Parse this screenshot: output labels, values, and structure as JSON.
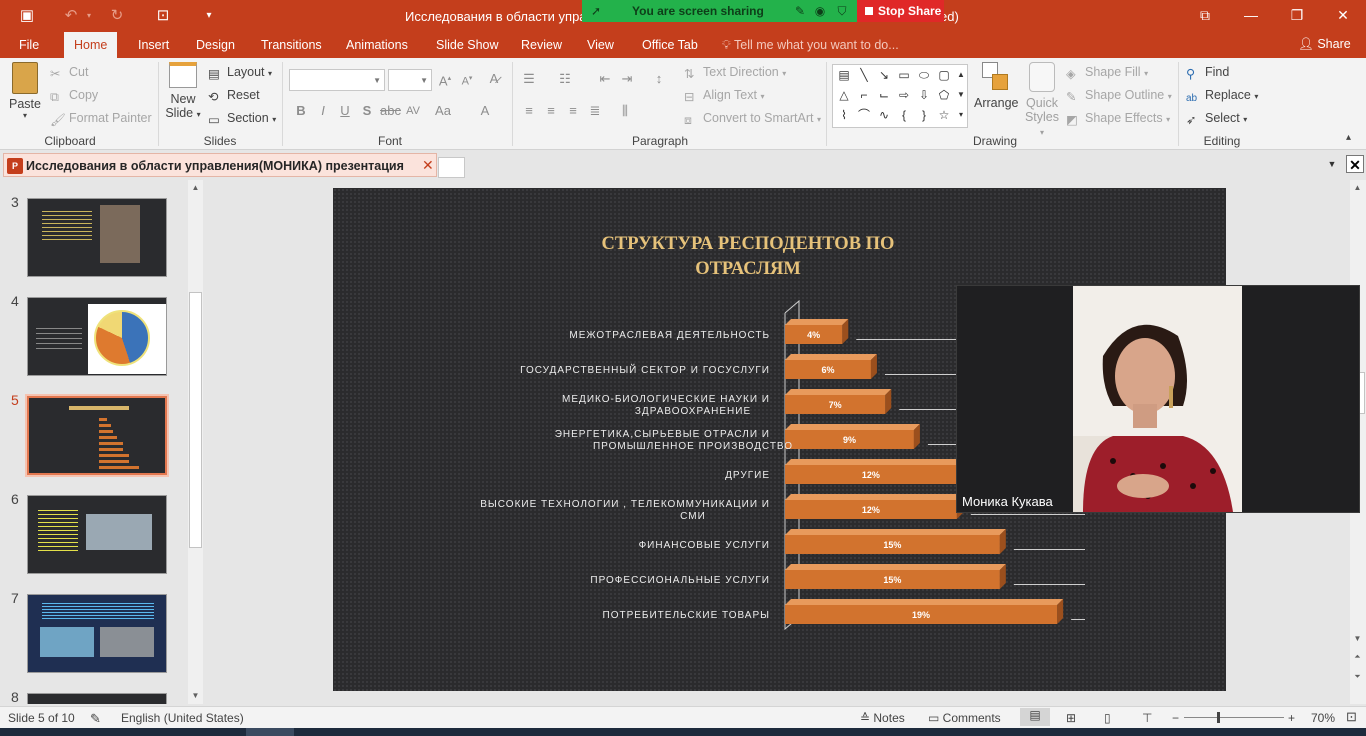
{
  "titlebar": {
    "window_title": "Исследования в области управл",
    "title_tail": "ed)",
    "minimize": "—",
    "restore": "❐",
    "close": "✕",
    "ribbon_display": "⧉"
  },
  "share_banner": {
    "text": "You are screen sharing",
    "stop_label": "Stop Share"
  },
  "menu": {
    "tabs": [
      "File",
      "Home",
      "Insert",
      "Design",
      "Transitions",
      "Animations",
      "Slide Show",
      "Review",
      "View",
      "Office Tab"
    ],
    "active": "Home",
    "tell_me": "Tell me what you want to do...",
    "share": "Share"
  },
  "ribbon": {
    "clipboard": {
      "label": "Clipboard",
      "paste": "Paste",
      "cut": "Cut",
      "copy": "Copy",
      "format_painter": "Format Painter"
    },
    "slides": {
      "label": "Slides",
      "new_slide": "New",
      "new_slide_2": "Slide",
      "layout": "Layout",
      "reset": "Reset",
      "section": "Section"
    },
    "font": {
      "label": "Font"
    },
    "paragraph": {
      "label": "Paragraph",
      "text_direction": "Text Direction",
      "align_text": "Align Text",
      "convert_smartart": "Convert to SmartArt"
    },
    "drawing": {
      "label": "Drawing",
      "arrange": "Arrange",
      "quick_styles": "Quick",
      "quick_styles_2": "Styles",
      "shape_fill": "Shape Fill",
      "shape_outline": "Shape Outline",
      "shape_effects": "Shape Effects"
    },
    "editing": {
      "label": "Editing",
      "find": "Find",
      "replace": "Replace",
      "select": "Select"
    }
  },
  "doc_tab": {
    "title": "Исследования в области управления(МОНИКА) презентация",
    "close": "✕"
  },
  "thumbnails": [
    {
      "num": "3"
    },
    {
      "num": "4"
    },
    {
      "num": "5"
    },
    {
      "num": "6"
    },
    {
      "num": "7"
    },
    {
      "num": "8"
    }
  ],
  "slide": {
    "title_line1": "СТРУКТУРА РЕСПОДЕНТОВ ПО",
    "title_line2": "ОТРАСЛЯМ"
  },
  "chart_data": {
    "type": "bar",
    "orientation": "horizontal",
    "categories": [
      [
        "МЕЖОТРАСЛЕВАЯ ДЕЯТЕЛЬНОСТЬ"
      ],
      [
        "ГОСУДАРСТВЕННЫЙ СЕКТОР И ГОСУСЛУГИ"
      ],
      [
        "МЕДИКО-БИОЛОГИЧЕСКИЕ НАУКИ И",
        "ЗДРАВООХРАНЕНИЕ"
      ],
      [
        "ЭНЕРГЕТИКА,СЫРЬЕВЫЕ ОТРАСЛИ И",
        "ПРОМЫШЛЕННОЕ ПРОИЗВОДСТВО"
      ],
      [
        "ДРУГИЕ"
      ],
      [
        "ВЫСОКИЕ ТЕХНОЛОГИИ , ТЕЛЕКОММУНИКАЦИИ И",
        "СМИ"
      ],
      [
        "ФИНАНСОВЫЕ УСЛУГИ"
      ],
      [
        "ПРОФЕССИОНАЛЬНЫЕ УСЛУГИ"
      ],
      [
        "ПОТРЕБИТЕЛЬСКИЕ ТОВАРЫ"
      ]
    ],
    "values": [
      4,
      6,
      7,
      9,
      12,
      12,
      15,
      15,
      19
    ],
    "data_labels": [
      "4%",
      "6%",
      "7%",
      "9%",
      "12%",
      "12%",
      "15%",
      "15%",
      "19%"
    ],
    "xlim": [
      0,
      20
    ],
    "bar_color": "#d2732e",
    "grid": true,
    "legend": "none"
  },
  "video": {
    "speaker": "Моника Кукава"
  },
  "statusbar": {
    "slide_info": "Slide 5 of 10",
    "language": "English (United States)",
    "notes": "Notes",
    "comments": "Comments",
    "zoom": "70%",
    "zoom_minus": "−",
    "zoom_plus": "+"
  },
  "colors": {
    "accent": "#c43e1c",
    "share_green": "#23b24b",
    "stop_red": "#e02828",
    "slide_title": "#e6c27a"
  }
}
